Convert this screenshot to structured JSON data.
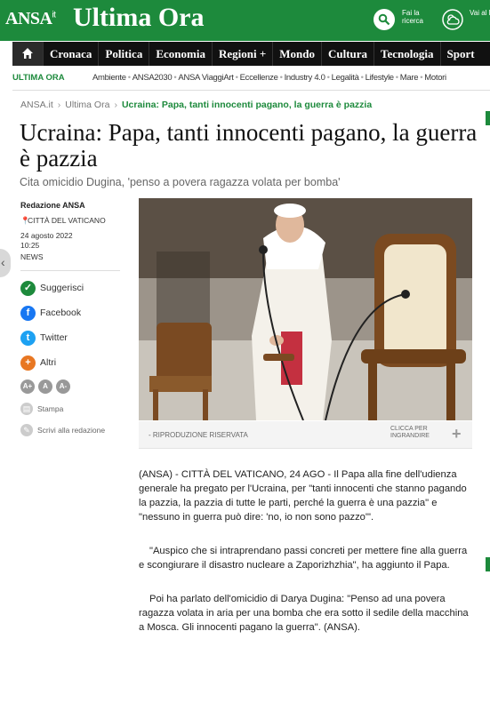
{
  "header": {
    "logo": "ANSA",
    "logo_sup": "it",
    "title": "Ultima Ora",
    "search_label": "Fai la ricerca",
    "meteo_label": "Vai al Meteo"
  },
  "nav": {
    "items": [
      "Cronaca",
      "Politica",
      "Economia",
      "Regioni +",
      "Mondo",
      "Cultura",
      "Tecnologia",
      "Sport"
    ]
  },
  "subnav": {
    "label": "ULTIMA ORA",
    "links": [
      "Ambiente",
      "ANSA2030",
      "ANSA ViaggiArt",
      "Eccellenze",
      "Industry 4.0",
      "Legalità",
      "Lifestyle",
      "Mare",
      "Motori"
    ]
  },
  "breadcrumb": {
    "items": [
      "ANSA.it",
      "Ultima Ora"
    ],
    "current": "Ucraina: Papa, tanti innocenti pagano, la guerra è pazzia"
  },
  "article": {
    "title": "Ucraina: Papa, tanti innocenti pagano, la guerra è pazzia",
    "subtitle": "Cita omicidio Dugina, 'penso a povera ragazza volata per bomba'",
    "source": "Redazione ANSA",
    "place": "CITTÀ DEL VATICANO",
    "date": "24 agosto 2022",
    "time": "10:25",
    "section": "NEWS",
    "photo_caption": "- RIPRODUZIONE RISERVATA",
    "enlarge_label": "CLICCA PER INGRANDIRE",
    "paragraphs": [
      "(ANSA) - CITTÀ DEL VATICANO, 24 AGO - Il Papa alla fine dell'udienza generale ha pregato per l'Ucraina, per \"tanti innocenti che stanno pagando la pazzia, la pazzia di tutte le parti, perché la guerra è una pazzia\" e \"nessuno in guerra può dire: 'no, io non sono pazzo'\".",
      "\"Auspico che si intraprendano passi concreti per mettere fine alla guerra e scongiurare il disastro nucleare a Zaporizhzhia\", ha aggiunto il Papa.",
      "Poi ha parlato dell'omicidio di Darya Dugina: \"Penso ad una povera ragazza volata in aria per una bomba che era sotto il sedile della macchina a Mosca. Gli innocenti pagano la guerra\". (ANSA)."
    ]
  },
  "share": {
    "suggest": "Suggerisci",
    "facebook": "Facebook",
    "twitter": "Twitter",
    "more": "Altri",
    "font_sizes": [
      "A+",
      "A",
      "A-"
    ],
    "print": "Stampa",
    "write": "Scrivi alla redazione"
  },
  "colors": {
    "brand_green": "#1d8a3c",
    "nav_bg": "#111111",
    "facebook": "#1877f2",
    "twitter": "#1da1f2",
    "more": "#e87722"
  }
}
